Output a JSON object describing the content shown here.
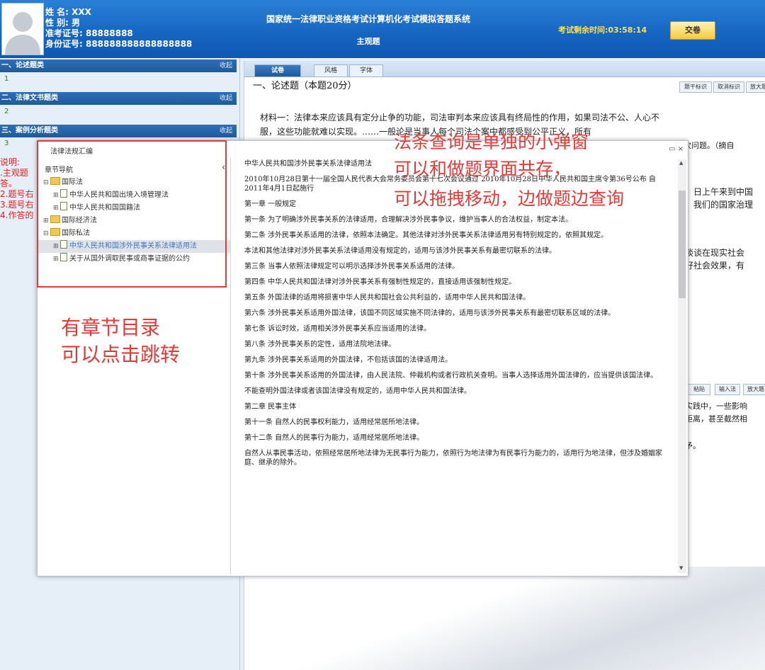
{
  "header": {
    "name": "姓 名: XXX",
    "gender": "性 别: 男",
    "exam_no": "准考证号: 88888888",
    "id_no": "身份证号: 888888888888888888",
    "system_title": "国家统一法律职业资格考试计算机化考试模拟答题系统",
    "subtitle": "主观题",
    "timer": "考试剩余时间:03:58:14",
    "submit": "交卷"
  },
  "sidebar": {
    "sections": [
      {
        "title": "一、论述题类",
        "collapse": "收起",
        "item": "1"
      },
      {
        "title": "二、法律文书题类",
        "collapse": "收起",
        "item": "2"
      },
      {
        "title": "三、案例分析题类",
        "collapse": "收起",
        "item": "3"
      }
    ],
    "note": [
      "说明:",
      ".主观题",
      "答。",
      "2.题号右",
      "3.题号右",
      "4.作答的"
    ]
  },
  "main": {
    "tabs": [
      "试卷",
      "风格",
      "字体"
    ],
    "question_title": "一、论述题（本题20分）",
    "tools": [
      "题干标识",
      "取消标识",
      "放大题"
    ],
    "material_line1": "材料一：法律本来应该具有定分止争的功能，司法审判本来应该具有终局性的作用，如果司法不公、人心不",
    "material_line2": "服，这些功能就难以实现。……一般论是当事人每个司法个案中都感受到公平正义，所有",
    "material_tail": "次问题。（摘自",
    "frag1": "日上午来到中国",
    "frag2": "我们的国家治理",
    "frag3": "谈谈在现实社会",
    "frag4": "好社会效果，有",
    "tools2": [
      "粘贴",
      "输入法",
      "放大题"
    ],
    "frag5": "实践中，一些影响",
    "frag6": "距离，甚至截然相",
    "frag7": "矛。"
  },
  "popup": {
    "title": "法律法规汇编",
    "controls": "▭ ×",
    "toc_title": "章节导航",
    "toc_collapse": "‹",
    "toc": [
      {
        "level": 0,
        "type": "folder",
        "pm": "⊟",
        "label": "国际法",
        "sel": false
      },
      {
        "level": 1,
        "type": "doc",
        "pm": "⊞",
        "label": "中华人民共和国出境入境管理法",
        "sel": false
      },
      {
        "level": 1,
        "type": "doc",
        "pm": "⊞",
        "label": "中华人民共和国国籍法",
        "sel": false
      },
      {
        "level": 0,
        "type": "folder",
        "pm": "⊞",
        "label": "国际经济法",
        "sel": false
      },
      {
        "level": 0,
        "type": "folder",
        "pm": "⊟",
        "label": "国际私法",
        "sel": false
      },
      {
        "level": 1,
        "type": "doc",
        "pm": "⊞",
        "label": "中华人民共和国涉外民事关系法律适用法",
        "sel": true
      },
      {
        "level": 1,
        "type": "doc",
        "pm": "⊞",
        "label": "关于从国外调取民事或商事证据的公约",
        "sel": false
      }
    ],
    "law": [
      "中华人民共和国涉外民事关系法律适用法",
      "2010年10月28日第十一届全国人民代表大会常务委员会第十七次会议通过 2010年10月28日中华人民共和国主席令第36号公布 自2011年4月1日起施行",
      "第一章 一般规定",
      "第一条 为了明确涉外民事关系的法律适用，合理解决涉外民事争议，维护当事人的合法权益，制定本法。",
      "第二条 涉外民事关系适用的法律，依照本法确定。其他法律对涉外民事关系法律适用另有特别规定的，依照其规定。",
      "本法和其他法律对涉外民事关系法律适用没有规定的，适用与该涉外民事关系有最密切联系的法律。",
      "第三条 当事人依照法律规定可以明示选择涉外民事关系适用的法律。",
      "第四条 中华人民共和国法律对涉外民事关系有强制性规定的，直接适用该强制性规定。",
      "第五条 外国法律的适用将损害中华人民共和国社会公共利益的，适用中华人民共和国法律。",
      "第六条 涉外民事关系适用外国法律，该国不同区域实施不同法律的，适用与该涉外民事关系有最密切联系区域的法律。",
      "第七条 诉讼时效，适用相关涉外民事关系应当适用的法律。",
      "第八条 涉外民事关系的定性，适用法院地法律。",
      "第九条 涉外民事关系适用的外国法律，不包括该国的法律适用法。",
      "第十条 涉外民事关系适用的外国法律，由人民法院、仲裁机构或者行政机关查明。当事人选择适用外国法律的，应当提供该国法律。",
      "不能查明外国法律或者该国法律没有规定的，适用中华人民共和国法律。",
      "第二章 民事主体",
      "第十一条 自然人的民事权利能力，适用经常居所地法律。",
      "第十二条 自然人的民事行为能力，适用经常居所地法律。",
      "自然人从事民事活动，依照经常居所地法律为无民事行为能力，依照行为地法律为有民事行为能力的，适用行为地法律，但涉及婚姻家庭、继承的除外。"
    ]
  },
  "annotations": {
    "right": [
      "法条查询是单独的小弹窗",
      "可以和做题界面共存，",
      "可以拖拽移动，边做题边查询"
    ],
    "left": [
      "有章节目录",
      "可以点击跳转"
    ]
  }
}
